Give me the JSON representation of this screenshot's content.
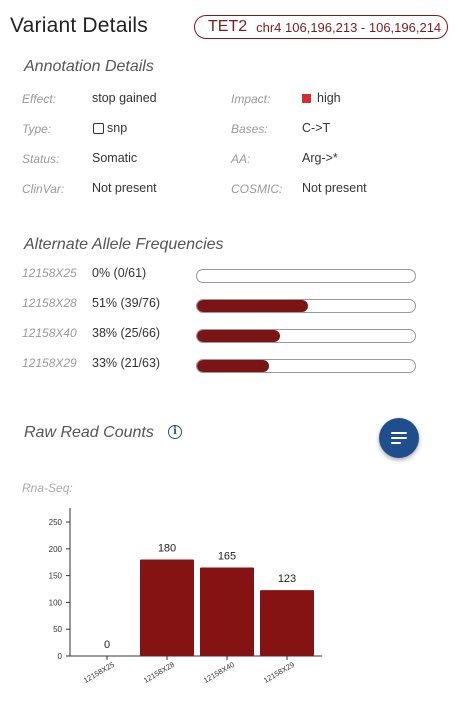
{
  "header": {
    "title": "Variant Details",
    "gene": "TET2",
    "location": "chr4 106,196,213 - 106,196,214"
  },
  "annotation": {
    "section_title": "Annotation Details",
    "effect": {
      "label": "Effect:",
      "value": "stop gained"
    },
    "impact": {
      "label": "Impact:",
      "value": "high",
      "color": "#d32f2f"
    },
    "type": {
      "label": "Type:",
      "value": "snp"
    },
    "bases": {
      "label": "Bases:",
      "value": "C->T"
    },
    "status": {
      "label": "Status:",
      "value": "Somatic"
    },
    "aa": {
      "label": "AA:",
      "value": "Arg->*"
    },
    "clinvar": {
      "label": "ClinVar:",
      "value": "Not present"
    },
    "cosmic": {
      "label": "COSMIC:",
      "value": "Not present"
    }
  },
  "allele_frequencies": {
    "section_title": "Alternate Allele Frequencies",
    "bar_color": "#7b1414",
    "rows": [
      {
        "sample": "12158X25",
        "value": "0% (0/61)",
        "fraction": 0.0
      },
      {
        "sample": "12158X28",
        "value": "51% (39/76)",
        "fraction": 0.51
      },
      {
        "sample": "12158X40",
        "value": "38% (25/66)",
        "fraction": 0.38
      },
      {
        "sample": "12158X29",
        "value": "33% (21/63)",
        "fraction": 0.33
      }
    ]
  },
  "raw_read_counts": {
    "section_title": "Raw Read Counts",
    "info_icon": "info-icon",
    "menu_icon": "sort-lines-icon",
    "subtitle": "Rna-Seq:"
  },
  "chart_data": {
    "type": "bar",
    "categories": [
      "12158X25",
      "12158X28",
      "12158X40",
      "12158X29"
    ],
    "values": [
      0,
      180,
      165,
      123
    ],
    "ylim": [
      0,
      250
    ],
    "yticks": [
      0,
      50,
      100,
      150,
      200,
      250
    ],
    "bar_color": "#861313",
    "data_labels": true,
    "title": "",
    "xlabel": "",
    "ylabel": ""
  }
}
